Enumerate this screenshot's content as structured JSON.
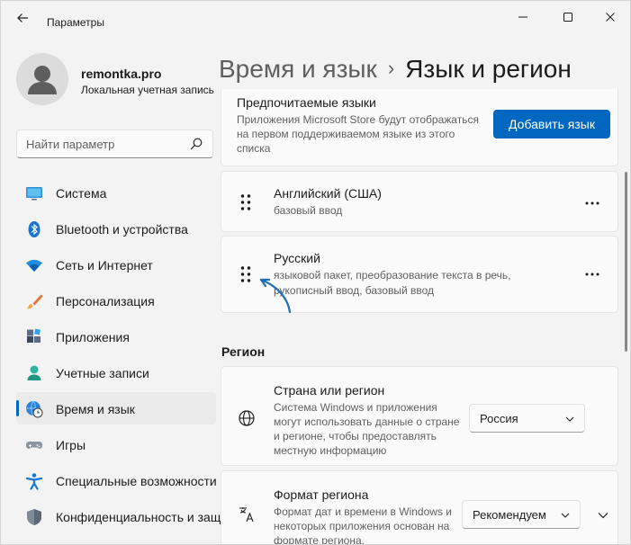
{
  "window": {
    "app_title": "Параметры",
    "back_label": "Назад",
    "minimize_label": "Свернуть",
    "maximize_label": "Развернуть",
    "close_label": "Закрыть"
  },
  "user": {
    "name": "remontka.pro",
    "account_type": "Локальная учетная запись"
  },
  "search": {
    "placeholder": "Найти параметр"
  },
  "nav": {
    "items": [
      {
        "label": "Система",
        "icon": "display-icon"
      },
      {
        "label": "Bluetooth и устройства",
        "icon": "bluetooth-icon"
      },
      {
        "label": "Сеть и Интернет",
        "icon": "wifi-icon"
      },
      {
        "label": "Персонализация",
        "icon": "brush-icon"
      },
      {
        "label": "Приложения",
        "icon": "apps-icon"
      },
      {
        "label": "Учетные записи",
        "icon": "person-icon"
      },
      {
        "label": "Время и язык",
        "icon": "time-language-icon"
      },
      {
        "label": "Игры",
        "icon": "gamepad-icon"
      },
      {
        "label": "Специальные возможности",
        "icon": "accessibility-icon"
      },
      {
        "label": "Конфиденциальность и защита",
        "icon": "shield-icon"
      }
    ],
    "active_index": 6
  },
  "breadcrumb": {
    "parent": "Время и язык",
    "separator": "›",
    "current": "Язык и регион"
  },
  "preferred": {
    "title": "Предпочитаемые языки",
    "description": "Приложения Microsoft Store будут отображаться на первом поддерживаемом языке из этого списка",
    "add_button": "Добавить язык"
  },
  "languages": [
    {
      "name": "Английский (США)",
      "description": "базовый ввод"
    },
    {
      "name": "Русский",
      "description": "языковой пакет, преобразование текста в речь, рукописный ввод, базовый ввод"
    }
  ],
  "more_label": "•••",
  "region": {
    "heading": "Регион",
    "country": {
      "title": "Страна или регион",
      "description": "Система Windows и приложения могут использовать данные о стране и регионе, чтобы предоставлять местную информацию",
      "value": "Россия"
    },
    "format": {
      "title": "Формат региона",
      "description": "Формат дат и времени в Windows и некоторых приложения основан на формате региона.",
      "value": "Рекомендуем"
    }
  },
  "colors": {
    "accent": "#0067c0",
    "annotation_arrow": "#1f6fb5"
  }
}
